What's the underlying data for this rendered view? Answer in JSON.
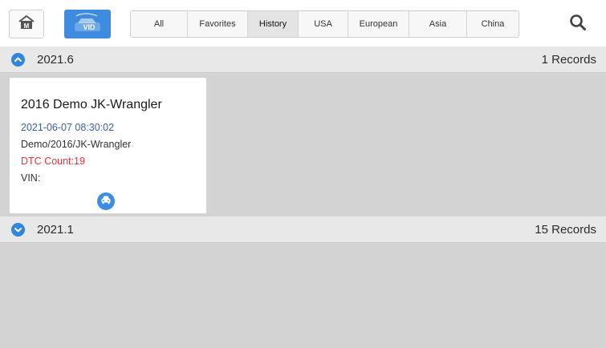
{
  "toolbar": {
    "home_icon": "home-m-icon",
    "vid_label": "VID",
    "tabs": [
      {
        "label": "All"
      },
      {
        "label": "Favorites"
      },
      {
        "label": "History"
      },
      {
        "label": "USA"
      },
      {
        "label": "European"
      },
      {
        "label": "Asia"
      },
      {
        "label": "China"
      }
    ],
    "active_tab": "History",
    "search_icon": "search-icon"
  },
  "groups": [
    {
      "title": "2021.6",
      "count": "1 Records",
      "expanded": true,
      "records": [
        {
          "name": "2016 Demo JK-Wrangler",
          "date": "2021-06-07 08:30:02",
          "path": "Demo/2016/JK-Wrangler",
          "dtc": "DTC Count:19",
          "vin": "VIN:"
        }
      ]
    },
    {
      "title": "2021.1",
      "count": "15 Records",
      "expanded": false
    }
  ],
  "colors": {
    "accent": "#2f86dc",
    "dtc": "#e53535",
    "date": "#3a5fa0",
    "content_bg": "#d3d3d3"
  }
}
